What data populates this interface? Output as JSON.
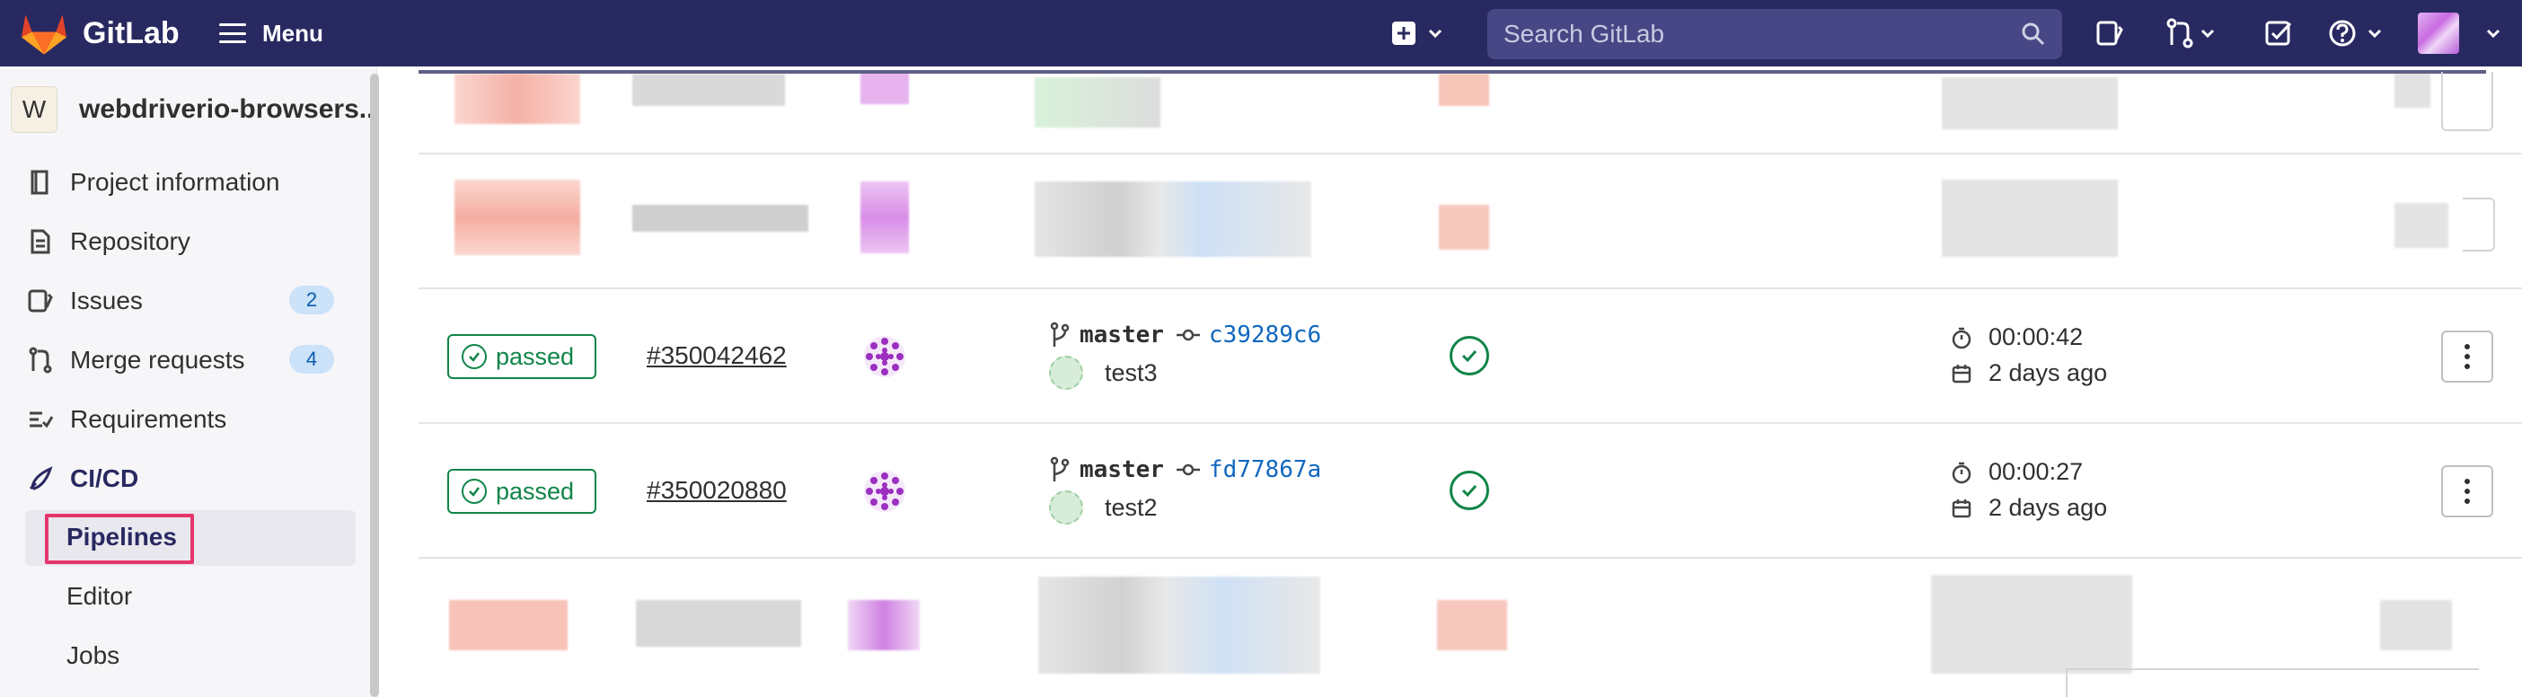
{
  "topbar": {
    "brand": "GitLab",
    "menu_label": "Menu",
    "search_placeholder": "Search GitLab",
    "colors": {
      "background": "#292961",
      "search_bg": "#474785"
    }
  },
  "sidebar": {
    "project_initial": "W",
    "project_name": "webdriverio-browsers..",
    "items": [
      {
        "label": "Project information",
        "icon": "book-icon"
      },
      {
        "label": "Repository",
        "icon": "document-icon"
      },
      {
        "label": "Issues",
        "icon": "issues-icon",
        "count": "2"
      },
      {
        "label": "Merge requests",
        "icon": "merge-request-icon",
        "count": "4"
      },
      {
        "label": "Requirements",
        "icon": "requirements-icon"
      },
      {
        "label": "CI/CD",
        "icon": "rocket-icon",
        "active": true
      }
    ],
    "subitems": [
      {
        "label": "Pipelines",
        "active": true
      },
      {
        "label": "Editor"
      },
      {
        "label": "Jobs"
      }
    ]
  },
  "pipelines": [
    {
      "status": "passed",
      "id": "#350042462",
      "branch": "master",
      "sha": "c39289c6",
      "commit_title": "test3",
      "duration": "00:00:42",
      "finished": "2 days ago"
    },
    {
      "status": "passed",
      "id": "#350020880",
      "branch": "master",
      "sha": "fd77867a",
      "commit_title": "test2",
      "duration": "00:00:27",
      "finished": "2 days ago"
    }
  ],
  "colors": {
    "success": "#108548",
    "link": "#1068bf",
    "highlight": "#e6356d"
  }
}
